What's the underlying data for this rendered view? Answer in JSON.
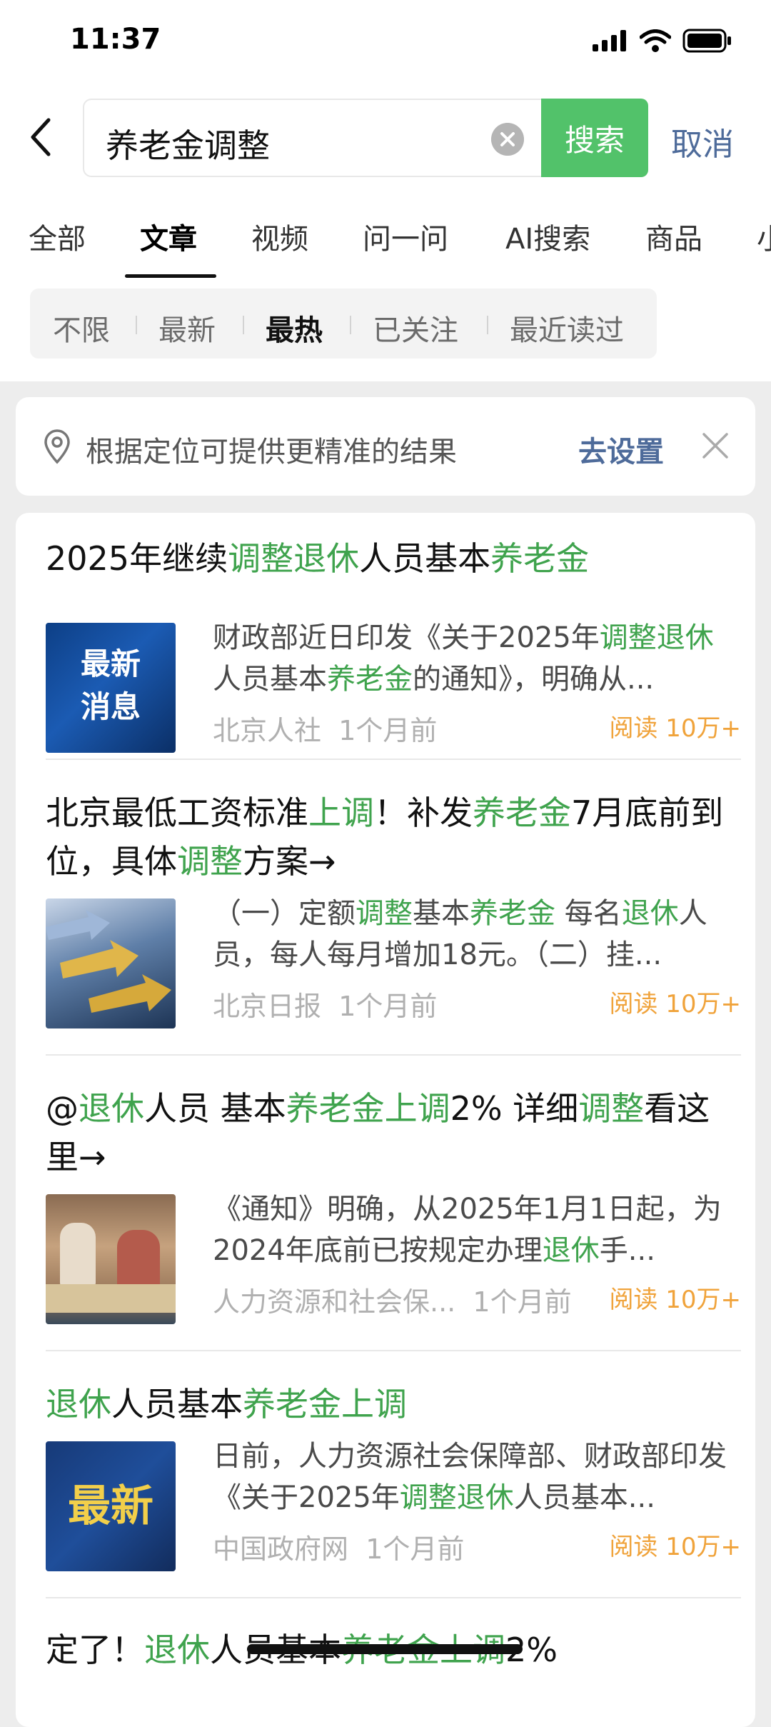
{
  "status_bar": {
    "time": "11:37"
  },
  "search": {
    "query": "养老金调整",
    "search_button": "搜索",
    "cancel": "取消"
  },
  "tabs": [
    "全部",
    "文章",
    "视频",
    "问一问",
    "AI搜索",
    "商品",
    "小"
  ],
  "active_tab": "文章",
  "filters": [
    "不限",
    "最新",
    "最热",
    "已关注",
    "最近读过"
  ],
  "active_filter": "最热",
  "location_banner": {
    "text": "根据定位可提供更精准的结果",
    "action": "去设置"
  },
  "results": [
    {
      "title": "2025年继续调整退休人员基本养老金",
      "desc": "财政部近日印发《关于2025年调整退休人员基本养老金的通知》，明确从...",
      "source": "北京人社",
      "time": "1个月前",
      "reads": "阅读 10万+",
      "thumb_text": "最新\n消息"
    },
    {
      "title": "北京最低工资标准上调！补发养老金7月底前到位，具体调整方案→",
      "desc": "（一）定额调整基本养老金 每名退休人员，每人每月增加18元。（二）挂...",
      "source": "北京日报",
      "time": "1个月前",
      "reads": "阅读 10万+"
    },
    {
      "title": "@退休人员 基本养老金上调2% 详细调整看这里→",
      "desc": "《通知》明确，从2025年1月1日起，为2024年底前已按规定办理退休手...",
      "source": "人力资源和社会保...",
      "time": "1个月前",
      "reads": "阅读 10万+"
    },
    {
      "title": "退休人员基本养老金上调",
      "desc": "日前，人力资源社会保障部、财政部印发《关于2025年调整退休人员基本...",
      "source": "中国政府网",
      "time": "1个月前",
      "reads": "阅读 10万+",
      "thumb_text": "最新"
    },
    {
      "title": "定了！退休人员基本养老金上调2%"
    }
  ],
  "colors": {
    "accent_green": "#52c26a",
    "highlight_green": "#3fa34d",
    "link_blue": "#4e6b9a",
    "read_orange": "#f0a33b"
  },
  "icons": [
    "signal-icon",
    "wifi-icon",
    "battery-icon",
    "back-arrow-icon",
    "clear-icon",
    "location-pin-icon",
    "close-icon"
  ]
}
